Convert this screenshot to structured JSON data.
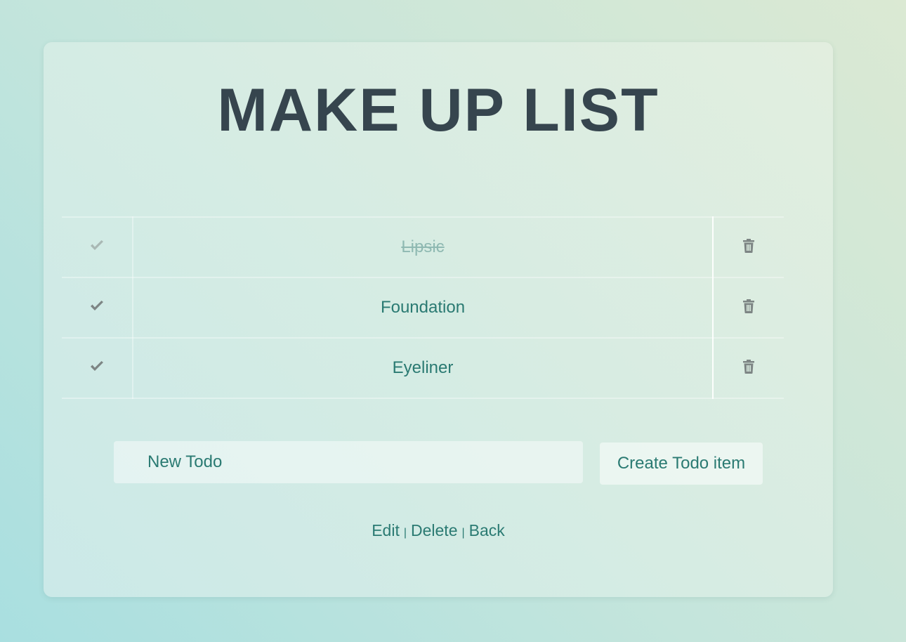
{
  "page": {
    "title": "MAKE UP LIST"
  },
  "todos": [
    {
      "label": "Lipsic",
      "done": true
    },
    {
      "label": "Foundation",
      "done": false
    },
    {
      "label": "Eyeliner",
      "done": false
    }
  ],
  "form": {
    "placeholder": "New Todo",
    "value": "",
    "create_label": "Create Todo item"
  },
  "links": {
    "edit": "Edit",
    "delete": "Delete",
    "back": "Back",
    "separator": "|"
  },
  "icons": {
    "complete": "check-icon",
    "remove": "trash-icon"
  },
  "colors": {
    "accent": "#2a7a72",
    "title": "#36454e",
    "icon": "#7d8584"
  }
}
